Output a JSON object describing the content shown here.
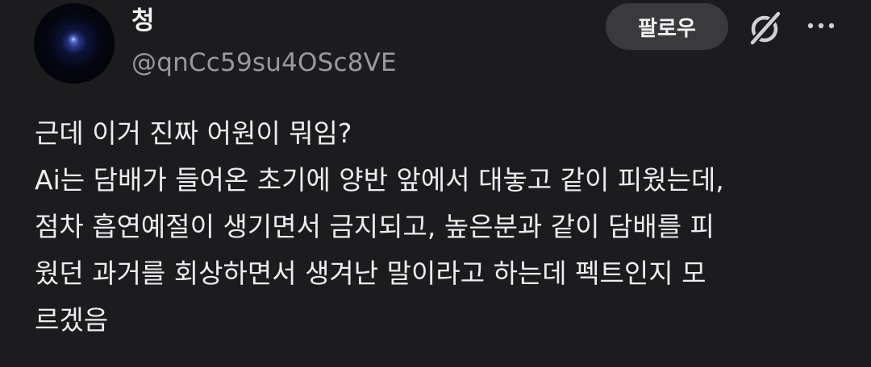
{
  "header": {
    "display_name": "청",
    "handle": "@qnCc59su4OSc8VE",
    "follow_label": "팔로우",
    "avatar_icon": "avatar-image",
    "grok_icon": "grok-icon",
    "more_icon": "more-icon"
  },
  "post": {
    "lines": [
      "근데 이거 진짜 어원이 뭐임?",
      "Ai는 담배가 들어온 초기에 양반 앞에서 대놓고 같이 피웠는데,",
      "점차 흡연예절이 생기면서 금지되고, 높은분과 같이 담배를 피",
      "웠던 과거를 회상하면서 생겨난 말이라고 하는데 펙트인지 모",
      "르겠음"
    ]
  },
  "colors": {
    "background": "#1c1b1d",
    "text": "#ededed",
    "secondary_text": "#9a9a9e",
    "button_bg": "#3a393c"
  }
}
